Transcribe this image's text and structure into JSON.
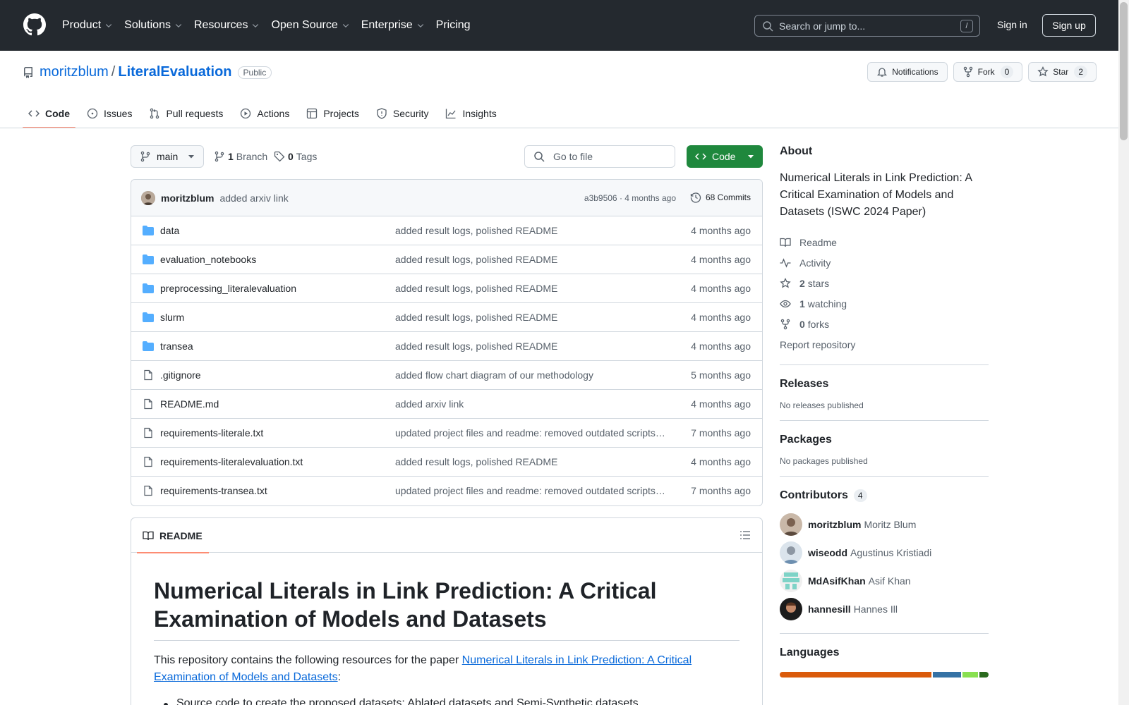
{
  "header": {
    "nav": [
      "Product",
      "Solutions",
      "Resources",
      "Open Source",
      "Enterprise",
      "Pricing"
    ],
    "search_placeholder": "Search or jump to...",
    "search_shortcut": "/",
    "sign_in": "Sign in",
    "sign_up": "Sign up"
  },
  "repo": {
    "owner": "moritzblum",
    "separator": "/",
    "name": "LiteralEvaluation",
    "visibility": "Public",
    "notifications_label": "Notifications",
    "fork_label": "Fork",
    "fork_count": "0",
    "star_label": "Star",
    "star_count": "2"
  },
  "tabs": [
    "Code",
    "Issues",
    "Pull requests",
    "Actions",
    "Projects",
    "Security",
    "Insights"
  ],
  "toolbar": {
    "branch": "main",
    "branch_count": "1",
    "branch_label": "Branch",
    "tag_count": "0",
    "tag_label": "Tags",
    "goto_placeholder": "Go to file",
    "code_label": "Code"
  },
  "commit": {
    "author": "moritzblum",
    "message": "added arxiv link",
    "meta": "a3b9506 · 4 months ago",
    "commits_label": "68 Commits"
  },
  "files": [
    {
      "type": "dir",
      "name": "data",
      "message": "added result logs, polished README",
      "date": "4 months ago"
    },
    {
      "type": "dir",
      "name": "evaluation_notebooks",
      "message": "added result logs, polished README",
      "date": "4 months ago"
    },
    {
      "type": "dir",
      "name": "preprocessing_literalevaluation",
      "message": "added result logs, polished README",
      "date": "4 months ago"
    },
    {
      "type": "dir",
      "name": "slurm",
      "message": "added result logs, polished README",
      "date": "4 months ago"
    },
    {
      "type": "dir",
      "name": "transea",
      "message": "added result logs, polished README",
      "date": "4 months ago"
    },
    {
      "type": "file",
      "name": ".gitignore",
      "message": "added flow chart diagram of our methodology",
      "date": "5 months ago"
    },
    {
      "type": "file",
      "name": "README.md",
      "message": "added arxiv link",
      "date": "4 months ago"
    },
    {
      "type": "file",
      "name": "requirements-literale.txt",
      "message": "updated project files and readme: removed outdated scripts…",
      "date": "7 months ago"
    },
    {
      "type": "file",
      "name": "requirements-literalevaluation.txt",
      "message": "added result logs, polished README",
      "date": "4 months ago"
    },
    {
      "type": "file",
      "name": "requirements-transea.txt",
      "message": "updated project files and readme: removed outdated scripts…",
      "date": "7 months ago"
    }
  ],
  "readme": {
    "tab_label": "README",
    "title": "Numerical Literals in Link Prediction: A Critical Examination of Models and Datasets",
    "intro_before": "This repository contains the following resources for the paper ",
    "intro_link": "Numerical Literals in Link Prediction: A Critical Examination of Models and Datasets",
    "intro_after": ":",
    "bullet_1": "Source code to create the proposed datasets: Ablated datasets and Semi-Synthetic datasets"
  },
  "sidebar": {
    "about_title": "About",
    "description": "Numerical Literals in Link Prediction: A Critical Examination of Models and Datasets (ISWC 2024 Paper)",
    "readme": "Readme",
    "activity": "Activity",
    "stars_count": "2",
    "stars_label": "stars",
    "watching_count": "1",
    "watching_label": "watching",
    "forks_count": "0",
    "forks_label": "forks",
    "report": "Report repository",
    "releases_title": "Releases",
    "releases_text": "No releases published",
    "packages_title": "Packages",
    "packages_text": "No packages published",
    "contributors_title": "Contributors",
    "contributors_count": "4",
    "contributors": [
      {
        "login": "moritzblum",
        "name": "Moritz Blum"
      },
      {
        "login": "wiseodd",
        "name": "Agustinus Kristiadi"
      },
      {
        "login": "MdAsifKhan",
        "name": "Asif Khan"
      },
      {
        "login": "hannesill",
        "name": "Hannes Ill"
      }
    ],
    "languages_title": "Languages"
  },
  "colors": {
    "accent": "#0969da",
    "header_bg": "#24292f",
    "code_button": "#1f883d",
    "tab_underline": "#fd8c73",
    "folder": "#54aeff"
  }
}
